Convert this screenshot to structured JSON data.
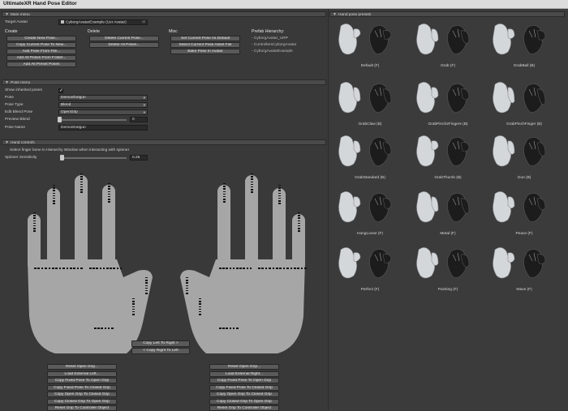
{
  "window": {
    "title": "UltimateXR Hand Pose Editor"
  },
  "main_menu": {
    "header": "Main menu",
    "target_avatar_label": "Target Avatar",
    "target_avatar_value": "CyborgAvatarExample (Uxr Avatar)",
    "create": {
      "header": "Create",
      "buttons": [
        "Create New Pose...",
        "Copy Current Pose To New...",
        "Add Pose From File...",
        "Add All Poses From Folder...",
        "Add All Preset Poses"
      ]
    },
    "delete": {
      "header": "Delete",
      "buttons": [
        "Delete Current Pose...",
        "Delete All Poses..."
      ]
    },
    "misc": {
      "header": "Misc",
      "buttons": [
        "Set Current Pose As Default",
        "Select Current Pose Asset File",
        "Bake Pose In Avatar"
      ]
    },
    "prefab_hierarchy": {
      "header": "Prefab Hierarchy:",
      "items": [
        "- CyborgAvatar_URP",
        "- ControllersCyborgAvatar",
        "- CyborgAvatarExample"
      ]
    }
  },
  "pose_menu": {
    "header": "Pose menu",
    "show_inherited_label": "Show inherited poses",
    "pose_label": "Pose",
    "pose_value": "DemoShotgun",
    "pose_type_label": "Pose Type",
    "pose_type_value": "Blend",
    "edit_blend_pose_label": "Edit Blend Pose",
    "edit_blend_pose_value": "OpenGrip",
    "preview_blend_label": "Preview Blend",
    "preview_blend_value": "0",
    "pose_name_label": "Pose Name",
    "pose_name_value": "DemoShotgun"
  },
  "hand_controls": {
    "header": "Hand controls",
    "hint": "Select finger bone in Hierarchy Window when interacting with spinner",
    "spinner_label": "Spinner Sensitivity",
    "spinner_value": "0.25",
    "copy_left_to_right": "Copy Left To Right >",
    "copy_right_to_left": "< Copy Right To Left",
    "left_buttons": [
      "Reset Open Grip...",
      "Load External Left...",
      "Copy Fixed Pose To Open Grip",
      "Copy Fixed Pose To Closed Grip",
      "Copy Open Grip To Closed Grip",
      "Copy Closed Grip To Open Grip",
      "Reset Grip To Controller Object"
    ],
    "right_buttons": [
      "Reset Open Grip...",
      "Load External Right...",
      "Copy Fixed Pose To Open Grip",
      "Copy Fixed Pose To Closed Grip",
      "Copy Open Grip To Closed Grip",
      "Copy Closed Grip To Open Grip",
      "Reset Grip To Controller Object"
    ]
  },
  "presets": {
    "header": "Hand pose presets",
    "items": [
      {
        "label": "Default (F)"
      },
      {
        "label": "Grab (F)"
      },
      {
        "label": "GrabBall (B)"
      },
      {
        "label": "GrabClaw (B)"
      },
      {
        "label": "GrabPinch2Fingers (B)"
      },
      {
        "label": "GrabPinchFinger (B)"
      },
      {
        "label": "GrabStandard (B)"
      },
      {
        "label": "GrabThumb (B)"
      },
      {
        "label": "Gun (B)"
      },
      {
        "label": "HangLoose (F)"
      },
      {
        "label": "Metal (F)"
      },
      {
        "label": "Peace (F)"
      },
      {
        "label": "Perfect (F)"
      },
      {
        "label": "Pointing (F)"
      },
      {
        "label": "Wave (F)"
      }
    ]
  },
  "colors": {
    "background": "#383838",
    "hand_silhouette": "#a6a6a6",
    "button": "#5a5a5a",
    "field": "#2a2a2a",
    "glove_light": "#d4d7da",
    "glove_dark": "#1c1c1c"
  }
}
